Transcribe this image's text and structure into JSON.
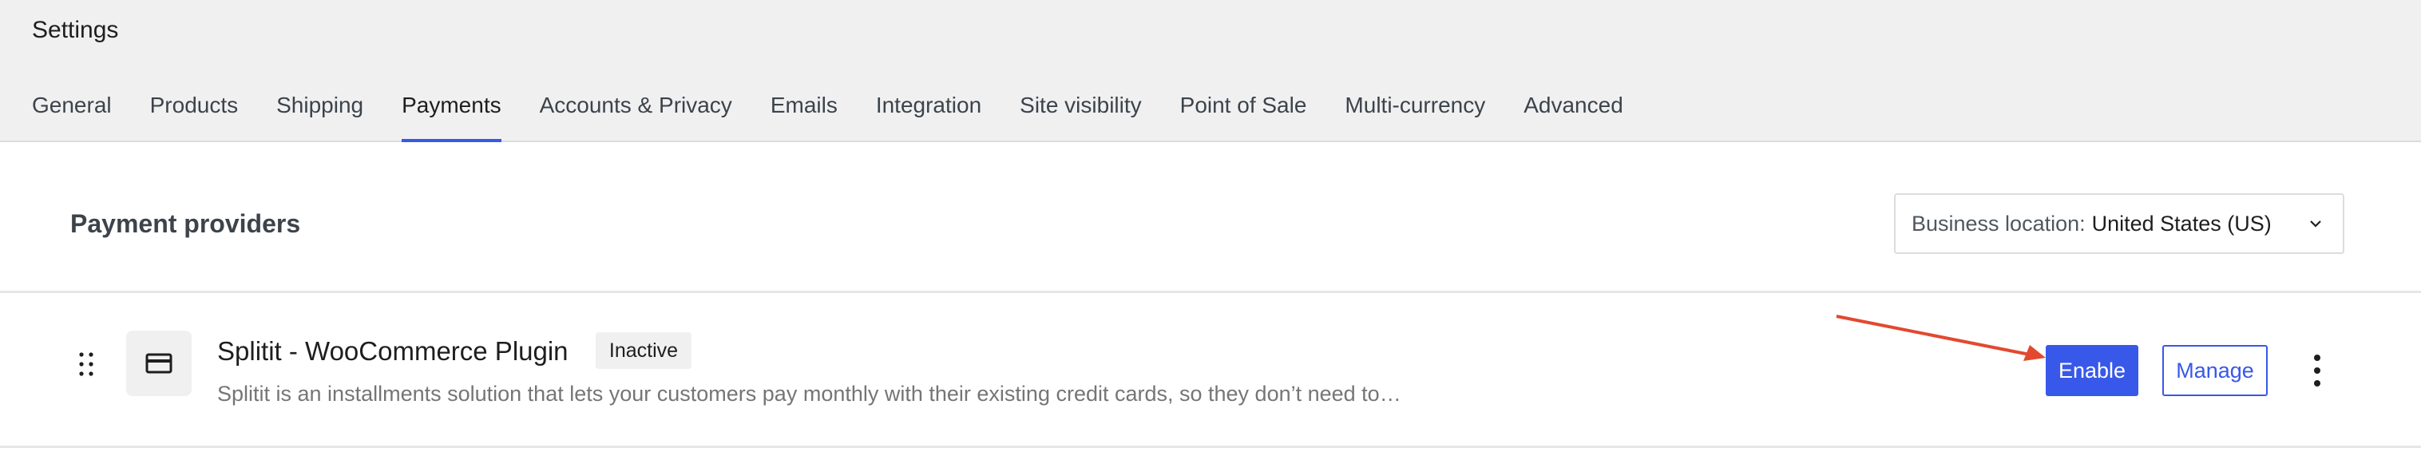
{
  "header": {
    "title": "Settings",
    "tabs": [
      {
        "label": "General"
      },
      {
        "label": "Products"
      },
      {
        "label": "Shipping"
      },
      {
        "label": "Payments",
        "active": true
      },
      {
        "label": "Accounts & Privacy"
      },
      {
        "label": "Emails"
      },
      {
        "label": "Integration"
      },
      {
        "label": "Site visibility"
      },
      {
        "label": "Point of Sale"
      },
      {
        "label": "Multi-currency"
      },
      {
        "label": "Advanced"
      }
    ]
  },
  "main": {
    "section_title": "Payment providers",
    "business_location": {
      "label": "Business location:",
      "value": "United States (US)"
    },
    "providers": [
      {
        "name": "Splitit - WooCommerce Plugin",
        "status": "Inactive",
        "description": "Splitit is an installments solution that lets your customers pay monthly with their existing credit cards, so they don’t need to…",
        "icon": "credit-card-icon",
        "enable_label": "Enable",
        "manage_label": "Manage"
      }
    ]
  },
  "colors": {
    "accent": "#3858e9",
    "annotation_arrow": "#e2492f",
    "header_bg": "#f0f0f1"
  }
}
